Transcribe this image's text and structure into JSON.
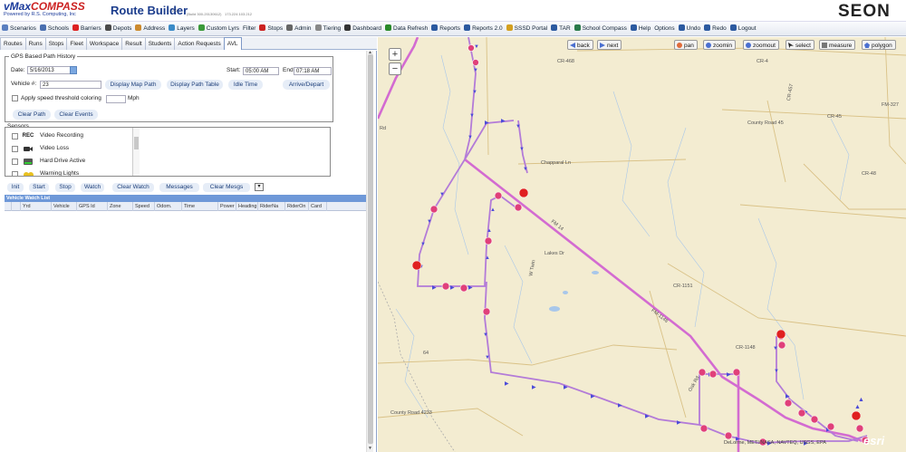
{
  "header": {
    "logo_line1": "vMaxCOMPASS",
    "logo_line2": "Powered by R.S. Computing, Inc",
    "title": "Route Builder",
    "version": "2.0",
    "build": "(Build 300-20130612)",
    "ip": "173.224.103.212",
    "brand": "SEON"
  },
  "menu": [
    {
      "label": "Scenarios",
      "icon": "scenarios-icon",
      "color": "#5b7fc0"
    },
    {
      "label": "Schools",
      "icon": "schools-icon",
      "color": "#4a6fb0"
    },
    {
      "label": "Barriers",
      "icon": "barriers-icon",
      "color": "#d22"
    },
    {
      "label": "Depots",
      "icon": "depots-icon",
      "color": "#4a4a4a"
    },
    {
      "label": "Address",
      "icon": "address-icon",
      "color": "#cc8a2e"
    },
    {
      "label": "Layers",
      "icon": "layers-icon",
      "color": "#3c8cc8"
    },
    {
      "label": "Custom Lyrs",
      "icon": "custom-layers-icon",
      "color": "#3a9a3a"
    },
    {
      "label": "Filter",
      "icon": "",
      "color": ""
    },
    {
      "label": "Stops",
      "icon": "stops-icon",
      "color": "#cc2222"
    },
    {
      "label": "Admin",
      "icon": "admin-icon",
      "color": "#666"
    },
    {
      "label": "Tiering",
      "icon": "tiering-icon",
      "color": "#888"
    },
    {
      "label": "Dashboard",
      "icon": "dashboard-icon",
      "color": "#333"
    },
    {
      "label": "Data Refresh",
      "icon": "data-refresh-icon",
      "color": "#2a8a2a"
    },
    {
      "label": "Reports",
      "icon": "reports-icon",
      "color": "#2c5aa0"
    },
    {
      "label": "Reports 2.0",
      "icon": "reports2-icon",
      "color": "#2c5aa0"
    },
    {
      "label": "SSSD Portal",
      "icon": "portal-icon",
      "color": "#d4a020"
    },
    {
      "label": "TAR",
      "icon": "tar-icon",
      "color": "#2c5aa0"
    },
    {
      "label": "School Compass",
      "icon": "compass-icon",
      "color": "#2a7a4a"
    },
    {
      "label": "Help",
      "icon": "help-icon",
      "color": "#2c5aa0"
    },
    {
      "label": "Options",
      "icon": "",
      "color": ""
    },
    {
      "label": "Undo",
      "icon": "undo-icon",
      "color": "#2c5aa0"
    },
    {
      "label": "Redo",
      "icon": "redo-icon",
      "color": "#2c5aa0"
    },
    {
      "label": "Logout",
      "icon": "logout-icon",
      "color": "#2c5aa0"
    }
  ],
  "tabs": [
    "Routes",
    "Runs",
    "Stops",
    "Fleet",
    "Workspace",
    "Result",
    "Students",
    "Action Requests",
    "AVL"
  ],
  "active_tab": "AVL",
  "gps": {
    "legend": "GPS Based Path History",
    "date_label": "Date:",
    "date_value": "5/16/2013",
    "start_label": "Start:",
    "start_value": "05:00 AM",
    "end_label": "End:",
    "end_value": "07:18 AM",
    "vehicle_label": "Vehicle #:",
    "vehicle_value": "23",
    "btn_display_map_path": "Display Map Path",
    "btn_display_path_table": "Display Path Table",
    "btn_idle_time": "Idle Time",
    "btn_arrive_depart": "Arrive/Depart",
    "speed_label": "Apply speed threshold coloring",
    "speed_unit": "Mph",
    "btn_clear_path": "Clear Path",
    "btn_clear_events": "Clear Events"
  },
  "sensors": {
    "legend": "Sensors",
    "items": [
      {
        "label": "Video Recording",
        "badge": "REC"
      },
      {
        "label": "Video Loss",
        "badge": ""
      },
      {
        "label": "Hard Drive Active",
        "badge": ""
      },
      {
        "label": "Warning Lights",
        "badge": ""
      }
    ]
  },
  "watch_buttons": [
    "Init",
    "Start",
    "Stop",
    "Watch",
    "Clear Watch",
    "Messages",
    "Clear Mesgs"
  ],
  "watch_list": {
    "title": "Vehicle Watch List",
    "columns": [
      "",
      "",
      "Yrd",
      "Vehicle",
      "GPS Id",
      "Zone",
      "Speed",
      "Odom.",
      "Time",
      "Power",
      "Heading",
      "RiderNa",
      "RiderOn",
      "Card"
    ]
  },
  "map": {
    "nav_back": "back",
    "nav_next": "next",
    "tools": [
      "pan",
      "zoomin",
      "zoomout",
      "select",
      "measure",
      "polygon"
    ],
    "zoom_in": "+",
    "zoom_out": "−",
    "road_labels": [
      "CR-468",
      "CR-4",
      "CR-457",
      "CR-45",
      "FM-327",
      "County Road 45",
      "CR-48",
      "Chapparal Ln",
      "Lakes Dr",
      "W Twin",
      "FM 14",
      "CR-1151",
      "FM-1148",
      "CR-1148",
      "64",
      "Oak Rd",
      "Rd",
      "County Road 4233"
    ],
    "attribution": "DeLorme, METI/NASA, NAVTEQ, USGS, EPA",
    "esri": "esri",
    "colors": {
      "route": "#d36bd1",
      "arrows": "#4b4bd8",
      "base": "#f3ecd1",
      "water": "#a8c7ea",
      "roads": "#d9c186"
    }
  }
}
